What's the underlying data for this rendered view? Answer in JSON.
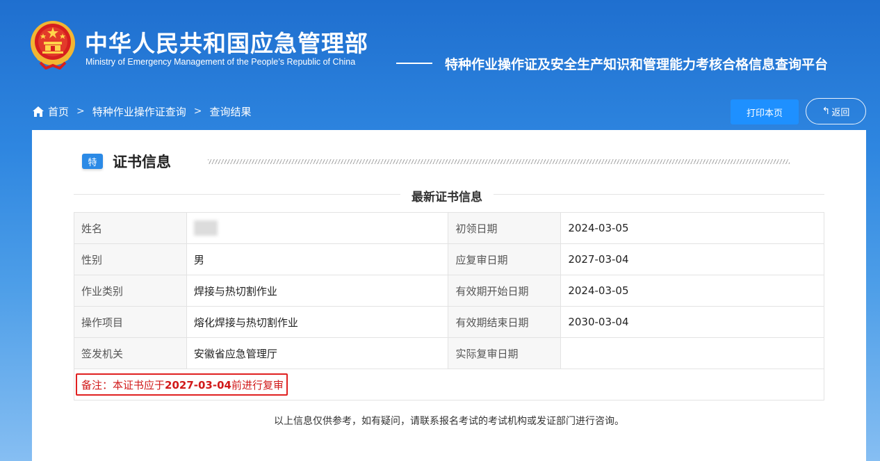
{
  "header": {
    "org_name_cn": "中华人民共和国应急管理部",
    "org_name_en": "Ministry of Emergency Management of the People’s Republic of China",
    "platform_title": "特种作业操作证及安全生产知识和管理能力考核合格信息查询平台",
    "emblem_icon": "national-emblem-icon"
  },
  "breadcrumb": {
    "items": [
      "首页",
      "特种作业操作证查询",
      "查询结果"
    ],
    "separator": ">"
  },
  "actions": {
    "print_label": "打印本页",
    "back_label": "返回",
    "back_glyph": "↰"
  },
  "section": {
    "badge": "特",
    "title": "证书信息",
    "subtitle": "最新证书信息"
  },
  "table": {
    "rows": [
      {
        "label1": "姓名",
        "value1": "",
        "label2": "初领日期",
        "value2": "2024-03-05"
      },
      {
        "label1": "性别",
        "value1": "男",
        "label2": "应复审日期",
        "value2": "2027-03-04"
      },
      {
        "label1": "作业类别",
        "value1": "焊接与热切割作业",
        "label2": "有效期开始日期",
        "value2": "2024-03-05"
      },
      {
        "label1": "操作项目",
        "value1": "熔化焊接与热切割作业",
        "label2": "有效期结束日期",
        "value2": "2030-03-04"
      },
      {
        "label1": "签发机关",
        "value1": "安徽省应急管理厅",
        "label2": "实际复审日期",
        "value2": ""
      }
    ]
  },
  "note": {
    "prefix": "备注：本证书应于",
    "date": "2027-03-04",
    "suffix": "前进行复审"
  },
  "footer": {
    "text": "以上信息仅供参考，如有疑问，请联系报名考试的考试机构或发证部门进行咨询。"
  },
  "colors": {
    "accent": "#1e90ff",
    "badge": "#2b8ae6",
    "note_red": "#d11a1a"
  }
}
